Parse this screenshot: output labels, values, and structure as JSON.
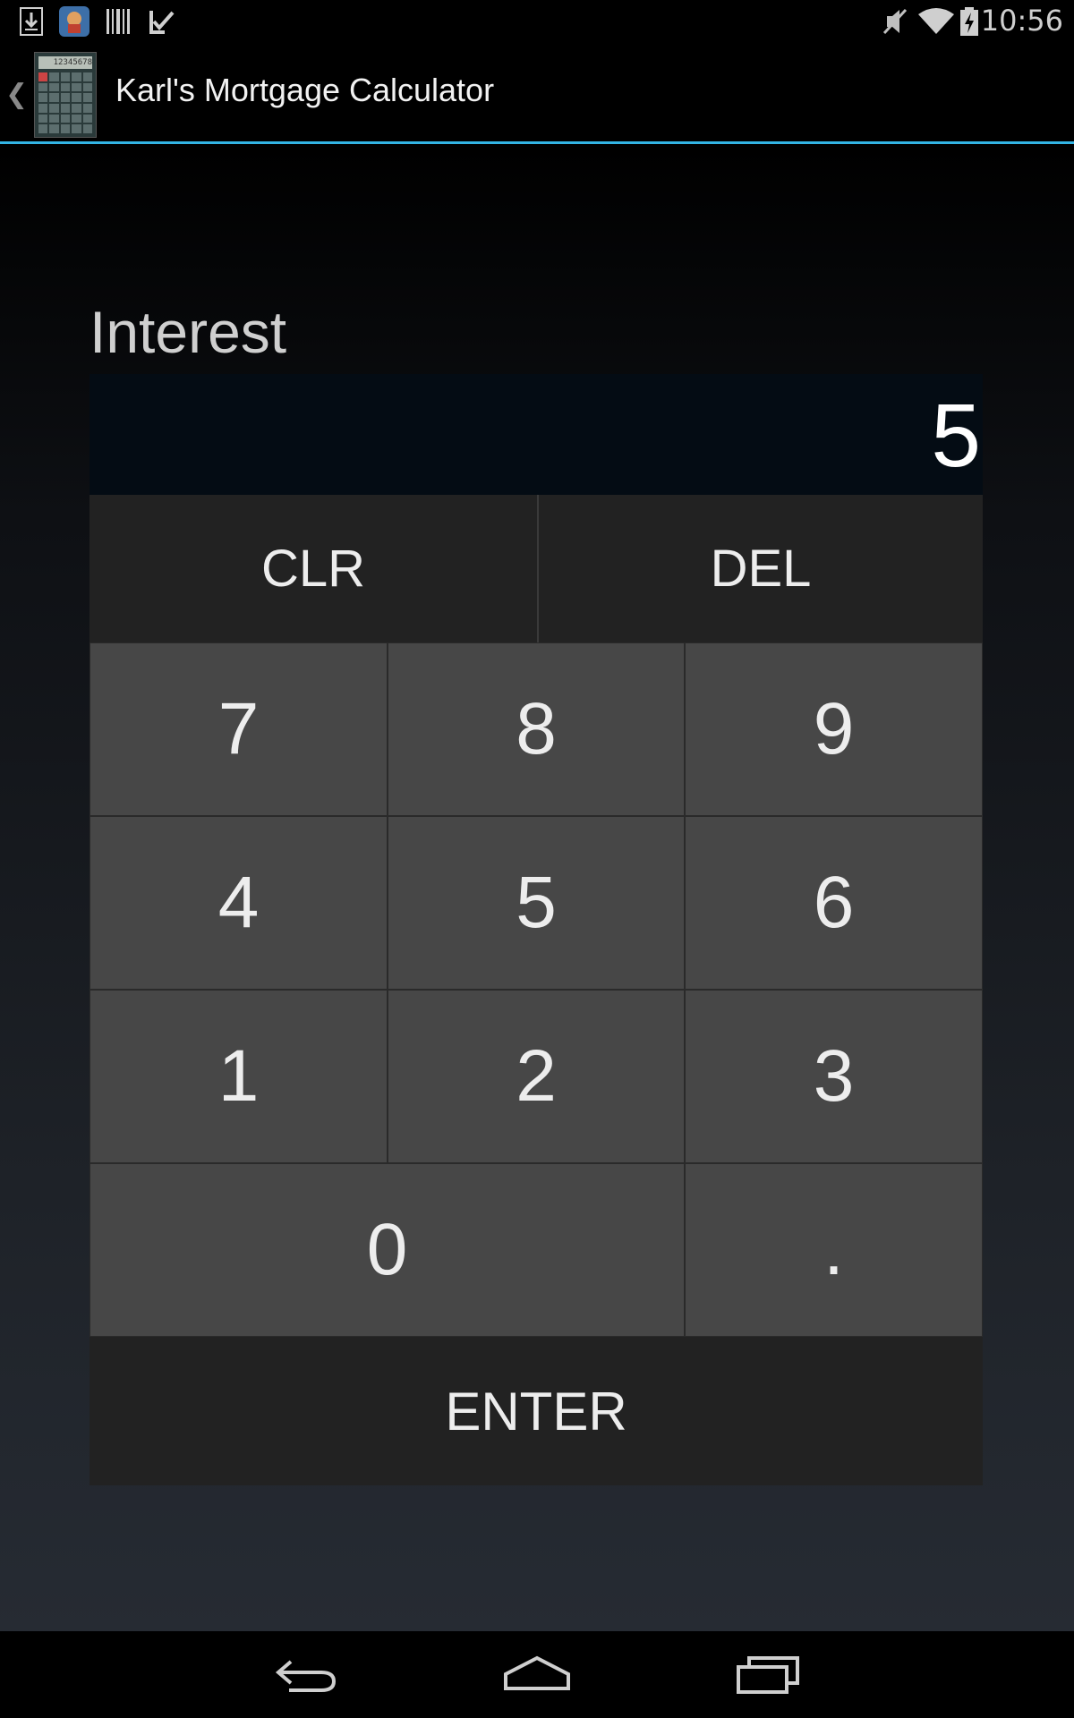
{
  "status_bar": {
    "time": "10:56",
    "left_icons": [
      "download-icon",
      "app-notification-icon",
      "barcode-icon",
      "checkmark-icon"
    ],
    "right_icons": [
      "mute-icon",
      "wifi-icon",
      "battery-charging-icon"
    ]
  },
  "action_bar": {
    "title": "Karl's Mortgage Calculator",
    "app_icon_display": "12345678",
    "accent_color": "#33b5e5"
  },
  "input": {
    "label": "Interest",
    "value": "5"
  },
  "keypad": {
    "clear": "CLR",
    "delete": "DEL",
    "keys": [
      "7",
      "8",
      "9",
      "4",
      "5",
      "6",
      "1",
      "2",
      "3"
    ],
    "zero": "0",
    "decimal": ".",
    "enter": "ENTER"
  },
  "nav_bar": {
    "buttons": [
      "back-icon",
      "home-icon",
      "recent-apps-icon"
    ]
  }
}
